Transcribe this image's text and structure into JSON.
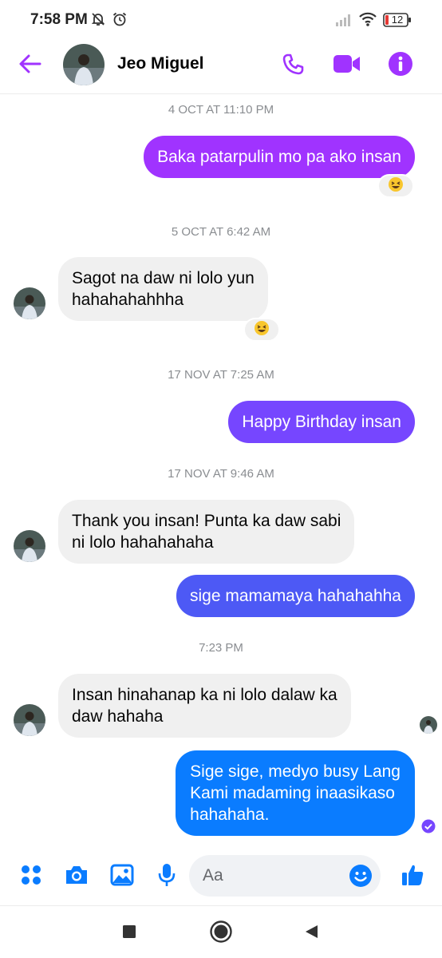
{
  "status_bar": {
    "time": "7:58 PM",
    "battery_level": "12",
    "icons": [
      "mute-bell-icon",
      "alarm-icon",
      "signal-icon",
      "wifi-icon",
      "battery-icon"
    ]
  },
  "header": {
    "contact_name": "Jeo Miguel",
    "icons": [
      "back-arrow-icon",
      "phone-icon",
      "video-icon",
      "info-icon"
    ],
    "accent_color": "#a033ff"
  },
  "messages": {
    "ts1": "4 OCT AT 11:10 PM",
    "m1": "Baka patarpulin mo pa ako insan",
    "ts2": "5 OCT AT 6:42 AM",
    "m2_line1": "Sagot na daw ni lolo yun",
    "m2_line2": "hahahahahhha",
    "ts3": "17 NOV AT 7:25 AM",
    "m3": "Happy Birthday insan",
    "ts4": "17 NOV AT 9:46 AM",
    "m4_line1": "Thank you insan! Punta ka daw sabi",
    "m4_line2": "ni lolo hahahahaha",
    "m5": "sige mamamaya hahahahha",
    "ts5": "7:23 PM",
    "m6_line1": "Insan hinahanap ka ni lolo dalaw ka",
    "m6_line2": "daw hahaha",
    "m7_line1": "Sige sige, medyo busy Lang",
    "m7_line2": "Kami madaming inaasikaso",
    "m7_line3": "hahahaha.",
    "reaction_emoji": "laughing-emoji",
    "bubble_colors": {
      "purple": "#a033ff",
      "violet": "#7646ff",
      "indigo": "#4d59f5",
      "blue": "#0a7cff",
      "incoming": "#f0f0f0"
    }
  },
  "composer": {
    "placeholder": "Aa",
    "icons": [
      "apps-grid-icon",
      "camera-icon",
      "gallery-icon",
      "microphone-icon",
      "emoji-icon",
      "thumbs-up-icon"
    ],
    "icon_color": "#0a7cff"
  },
  "nav_bar": {
    "icons": [
      "recents-square-icon",
      "home-circle-icon",
      "back-triangle-icon"
    ]
  }
}
